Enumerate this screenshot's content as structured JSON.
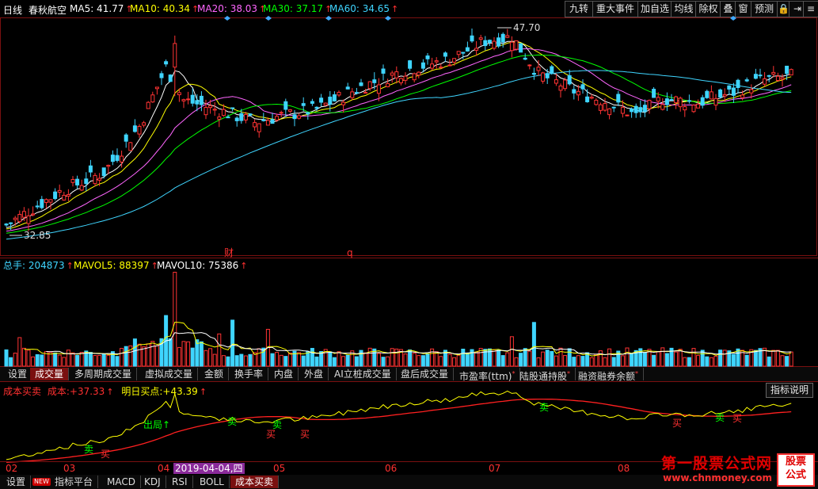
{
  "kline": {
    "period": "日线",
    "stock_name": "春秋航空",
    "ma_values": [
      {
        "label": "MA5:",
        "value": "41.77",
        "color": "#ffffff"
      },
      {
        "label": "MA10:",
        "value": "40.34",
        "color": "#ffff00"
      },
      {
        "label": "MA20:",
        "value": "38.03",
        "color": "#ff66ff"
      },
      {
        "label": "MA30:",
        "value": "37.17",
        "color": "#00ff00"
      },
      {
        "label": "MA60:",
        "value": "34.65",
        "color": "#3fd5ff"
      }
    ],
    "high_label": "47.70",
    "low_label": "32.85",
    "event_marks": [
      "财",
      "q"
    ]
  },
  "toolbar": [
    "九转",
    "重大事件",
    "加自选",
    "均线",
    "除权",
    "叠",
    "窗",
    "预测"
  ],
  "volume": {
    "labels": [
      {
        "label": "总手:",
        "value": "204873",
        "color": "#3fd5ff"
      },
      {
        "label": "MAVOL5:",
        "value": "88397",
        "color": "#ffff00"
      },
      {
        "label": "MAVOL10:",
        "value": "75386",
        "color": "#ffffff"
      }
    ]
  },
  "volume_tabs": [
    "设置",
    "成交量",
    "多周期成交量",
    "虚拟成交量",
    "金额",
    "换手率",
    "内盘",
    "外盘",
    "AI立桩成交量",
    "盘后成交量",
    "市盈率(ttm)",
    "陆股通持股",
    "融资融券余额"
  ],
  "indicator": {
    "name": "成本买卖",
    "cost_label": "成本:",
    "cost_value": "+37.33",
    "buy_label": "明日买点:",
    "buy_value": "+43.39",
    "explain_button": "指标说明",
    "signals": {
      "exit": "出局",
      "buy": "买",
      "sell": "卖"
    }
  },
  "axis": {
    "months": [
      "02",
      "03",
      "04",
      "05",
      "06",
      "07",
      "08"
    ],
    "highlight_date": "2019-04-04,四"
  },
  "bottom_tabs": [
    "设置",
    "指标平台",
    "MACD",
    "KDJ",
    "RSI",
    "BOLL",
    "成本买卖"
  ],
  "bottom_new_badge": "NEW",
  "watermark": {
    "title": "第一股票公式网",
    "url": "www.chnmoney.com",
    "box_top": "股票",
    "box_bottom": "公式"
  },
  "colors": {
    "up": "#ff3333",
    "down": "#3fd5ff",
    "ma5": "#ffffff",
    "ma10": "#ffff00",
    "ma20": "#ff66ff",
    "ma30": "#00ff00",
    "ma60": "#3fd5ff",
    "cost_line": "#ff2020",
    "price_line": "#ffff00"
  }
}
